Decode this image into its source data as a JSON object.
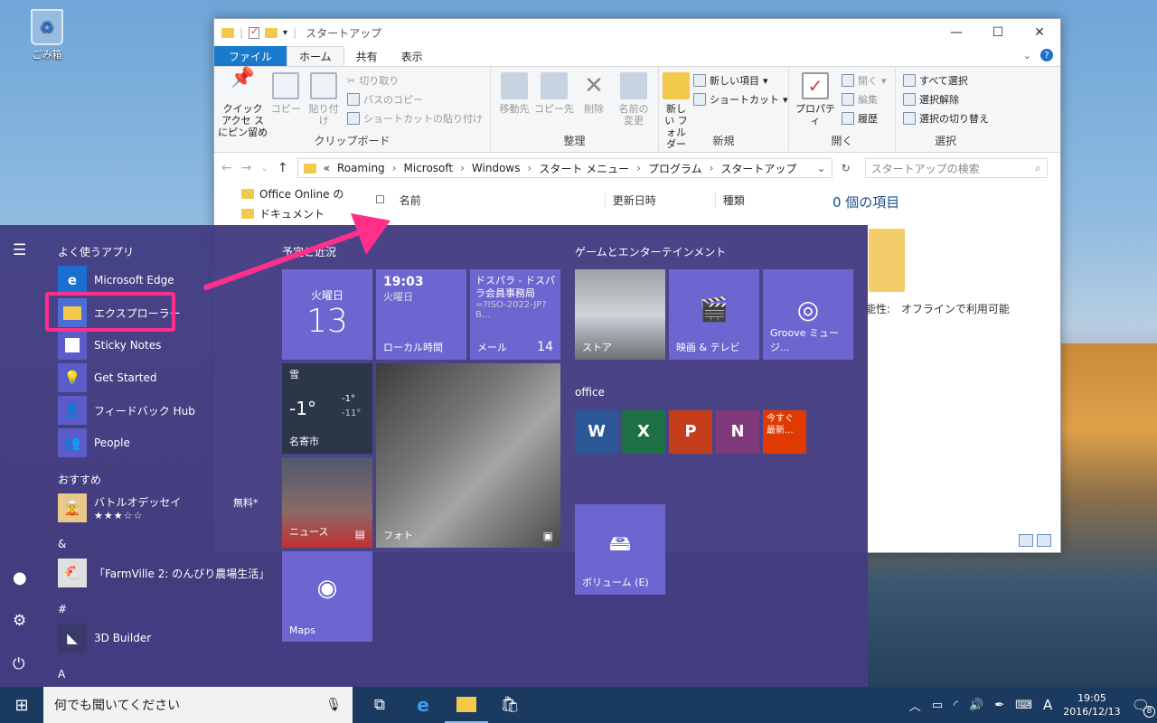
{
  "desktop": {
    "recycle_bin": "ごみ箱"
  },
  "explorer": {
    "title": "スタートアップ",
    "tabs": [
      "ファイル",
      "ホーム",
      "共有",
      "表示"
    ],
    "ribbon": {
      "clipboard": {
        "label": "クリップボード",
        "pin": "クイック アクセ スにピン留め",
        "copy": "コピー",
        "paste": "貼り付け",
        "cut": "切り取り",
        "copy_path": "パスのコピー",
        "paste_shortcut": "ショートカットの貼り付け"
      },
      "organize": {
        "label": "整理",
        "move": "移動先",
        "copy_to": "コピー先",
        "delete": "削除",
        "rename": "名前の 変更"
      },
      "new": {
        "label": "新規",
        "new_folder": "新しい フォルダー",
        "new_item": "新しい項目",
        "shortcut": "ショートカット"
      },
      "open": {
        "label": "開く",
        "properties": "プロパティ",
        "open": "開く",
        "edit": "編集",
        "history": "履歴"
      },
      "select": {
        "label": "選択",
        "all": "すべて選択",
        "none": "選択解除",
        "invert": "選択の切り替え"
      }
    },
    "address": [
      "«",
      "Roaming",
      "Microsoft",
      "Windows",
      "スタート メニュー",
      "プログラム",
      "スタートアップ"
    ],
    "search_placeholder": "スタートアップの検索",
    "nav_items": [
      "Office Online の",
      "ドキュメント"
    ],
    "columns": [
      "名前",
      "更新日時",
      "種類"
    ],
    "details_count": "0 個の項目",
    "availability_label": "能性:",
    "availability_value": "オフラインで利用可能"
  },
  "start": {
    "most_used": "よく使うアプリ",
    "apps": [
      "Microsoft Edge",
      "エクスプローラー",
      "Sticky Notes",
      "Get Started",
      "フィードバック Hub",
      "People"
    ],
    "recommended": "おすすめ",
    "rec_app": "バトルオデッセイ",
    "rec_free": "無料*",
    "rec_stars": "★★★☆☆",
    "amp": "&",
    "farmville": "「FarmVille 2: のんびり農場生活」",
    "hash": "#",
    "builder": "3D Builder",
    "letter_a": "A",
    "group1": "予定と近況",
    "group2": "ゲームとエンターテインメント",
    "group3": "office",
    "tiles": {
      "cal_day": "火曜日",
      "cal_date": "13",
      "clock_time": "19:03",
      "clock_day": "火曜日",
      "clock_label": "ローカル時間",
      "mail_sender": "ドスパラ - ドスパラ会員事務局",
      "mail_snippet": "=?ISO-2022-JP?B...",
      "mail_label": "メール",
      "mail_count": "14",
      "weather_cond": "雪",
      "weather_temp": "-1°",
      "weather_hi": "-1°",
      "weather_lo": "-11°",
      "weather_city": "名寄市",
      "news": "ニュース",
      "photo": "フォト",
      "maps": "Maps",
      "store": "ストア",
      "movies": "映画 & テレビ",
      "groove": "Groove ミュージ...",
      "onenote_promo": "今すぐ 最新...",
      "volume": "ボリューム (E)"
    }
  },
  "taskbar": {
    "search": "何でも聞いてください",
    "ime": "A",
    "time": "19:05",
    "date": "2016/12/13",
    "notif_count": "8"
  }
}
